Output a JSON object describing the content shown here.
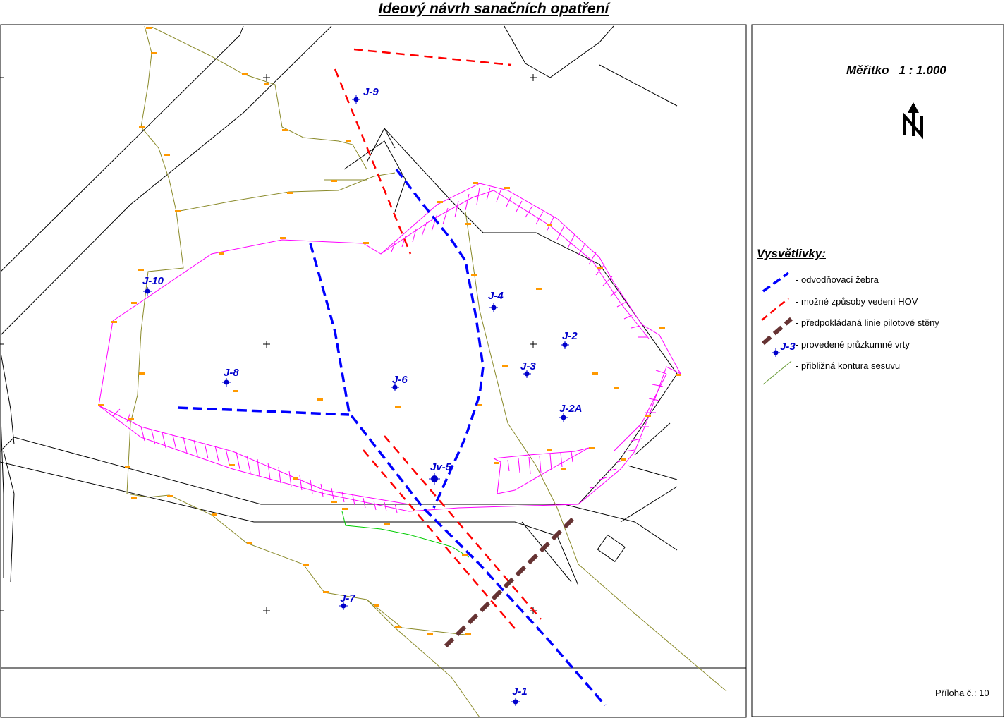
{
  "title": "Ideový návrh sanačních opatření",
  "scale": "Měřítko   1 : 1.000",
  "north_arrow": "north-arrow-icon",
  "legend": {
    "title": "Vysvětlivky:",
    "items": [
      {
        "label": "- odvodňovací žebra",
        "color": "#0000ff",
        "style": "dashed-thick"
      },
      {
        "label": "- možné způsoby vedení HOV",
        "color": "#ff0000",
        "style": "dashed"
      },
      {
        "label": "-  předpokládaná linie pilotové stěny",
        "color": "#663333",
        "style": "dashed-heavy"
      },
      {
        "label": "- provedené průzkumné vrty",
        "color": "#0000cc",
        "style": "well-marker",
        "marker_label": "J-3"
      },
      {
        "label": "- přibližná kontura sesuvu",
        "color": "#669933",
        "style": "thin"
      }
    ]
  },
  "wells": [
    {
      "label": "J-9"
    },
    {
      "label": "J-10"
    },
    {
      "label": "J-4"
    },
    {
      "label": "J-2"
    },
    {
      "label": "J-3"
    },
    {
      "label": "J-8"
    },
    {
      "label": "J-6"
    },
    {
      "label": "J-2A"
    },
    {
      "label": "Jv-5"
    },
    {
      "label": "J-7"
    },
    {
      "label": "J-1"
    }
  ],
  "attachment": "Příloha č.: 10",
  "colors": {
    "drain": "#0000ff",
    "hov": "#ff0000",
    "pile_wall": "#663333",
    "landslide": "#ff00ff",
    "contour": "#8a8a2a",
    "survey_point": "#ff9900"
  }
}
